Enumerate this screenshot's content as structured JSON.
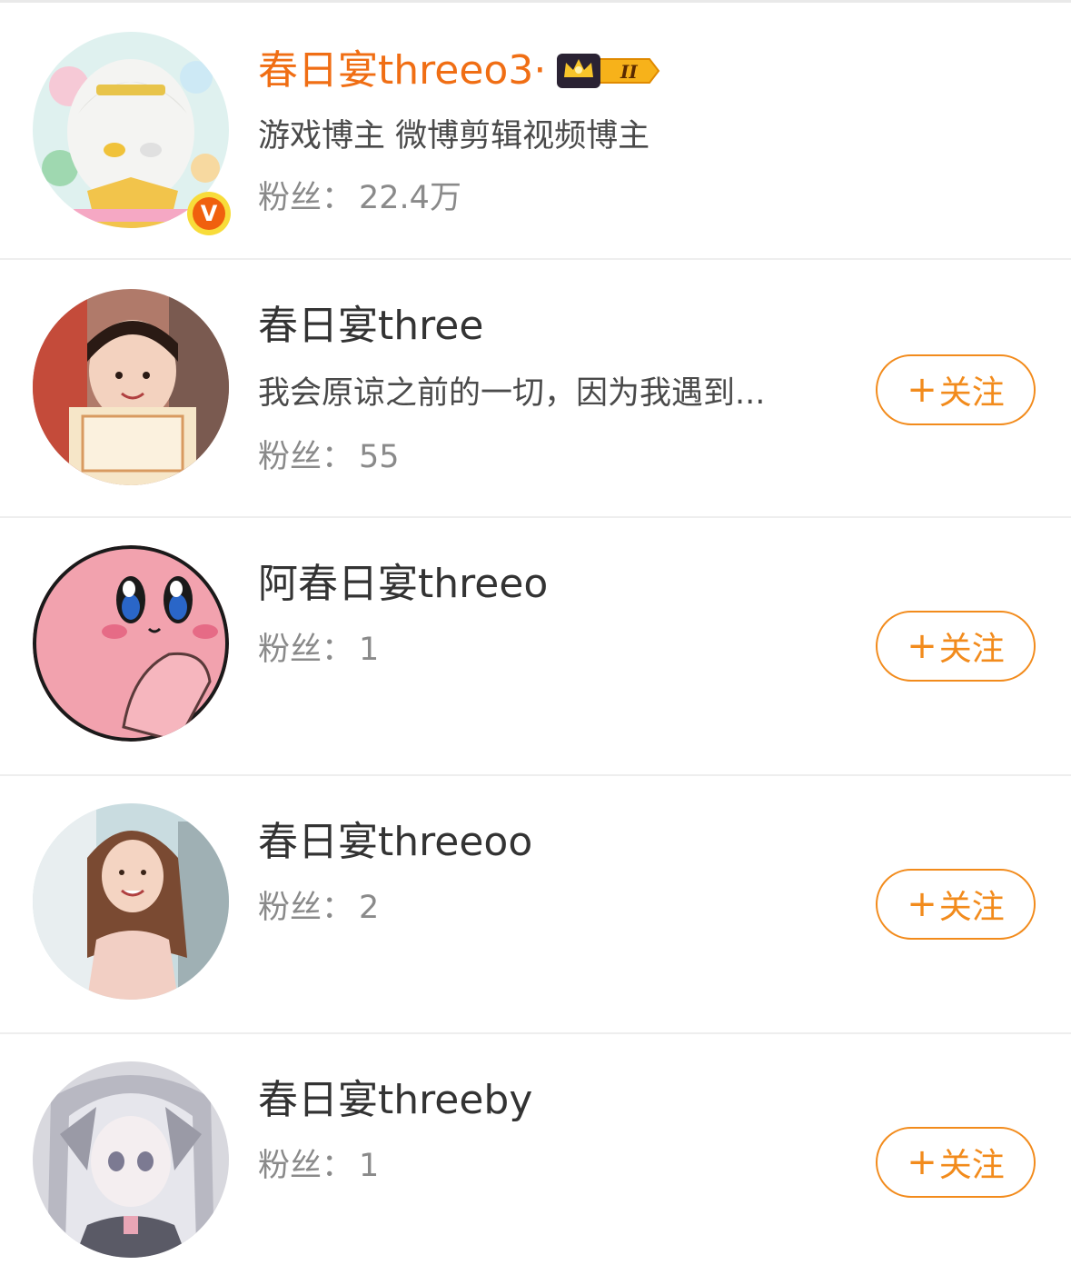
{
  "users": [
    {
      "name": "春日宴threeo3·",
      "desc": "游戏博主 微博剪辑视频博主",
      "fans_label": "粉丝：",
      "fans": "22.4万",
      "verified_badge": "V",
      "member_level": "II",
      "name_color": "#f06e14"
    },
    {
      "name": "春日宴three",
      "desc": "我会原谅之前的一切，因为我遇到...",
      "fans_label": "粉丝：",
      "fans": "55",
      "follow_label": "关注"
    },
    {
      "name": "阿春日宴threeo",
      "fans_label": "粉丝：",
      "fans": "1",
      "follow_label": "关注"
    },
    {
      "name": "春日宴threeoo",
      "fans_label": "粉丝：",
      "fans": "2",
      "follow_label": "关注"
    },
    {
      "name": "春日宴threeby",
      "fans_label": "粉丝：",
      "fans": "1",
      "follow_label": "关注"
    }
  ],
  "follow_plus": "+",
  "accent_color": "#f28b1c"
}
